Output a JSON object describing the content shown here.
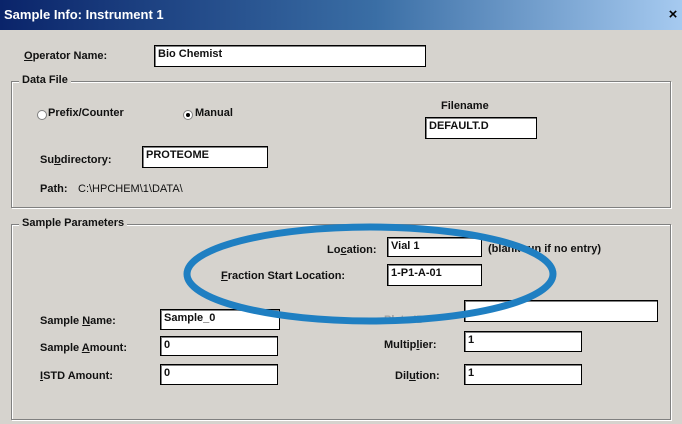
{
  "window": {
    "title": "Sample Info: Instrument 1",
    "close": "×"
  },
  "operator": {
    "label_pre": "",
    "label_u": "O",
    "label_post": "perator Name:",
    "value": "Bio Chemist"
  },
  "data_file": {
    "group": "Data File",
    "radio_prefix": "Prefix/Counter",
    "radio_manual": "Manual",
    "filename_label": "Filename",
    "filename_value": "DEFAULT.D",
    "subdir_label_pre": "Su",
    "subdir_label_u": "b",
    "subdir_label_post": "directory:",
    "subdir_value": "PROTEOME",
    "path_label": "Path:",
    "path_value": "C:\\HPCHEM\\1\\DATA\\"
  },
  "sample": {
    "group": "Sample Parameters",
    "location_label_pre": "Lo",
    "location_label_u": "c",
    "location_label_post": "ation:",
    "location_value": "Vial 1",
    "location_hint": "(blank run if no entry)",
    "fraction_label_pre": "",
    "fraction_label_u": "F",
    "fraction_label_post": "raction Start Location:",
    "fraction_value": "1-P1-A-01",
    "name_label_pre": "Sample ",
    "name_label_u": "N",
    "name_label_post": "ame:",
    "name_value": "Sample_0",
    "plate_label": "Plate ID",
    "amount_label_pre": "Sample ",
    "amount_label_u": "A",
    "amount_label_post": "mount:",
    "amount_value": "0",
    "multiplier_label_pre": "Multip",
    "multiplier_label_u": "l",
    "multiplier_label_post": "ier:",
    "multiplier_value": "1",
    "istd_label_pre": "",
    "istd_label_u": "I",
    "istd_label_post": "STD Amount:",
    "istd_value": "0",
    "dilution_label_pre": "Dil",
    "dilution_label_u": "u",
    "dilution_label_post": "tion:",
    "dilution_value": "1"
  },
  "colors": {
    "annotation_ellipse": "#1f7fc2",
    "titlebar": "#0a246a"
  }
}
